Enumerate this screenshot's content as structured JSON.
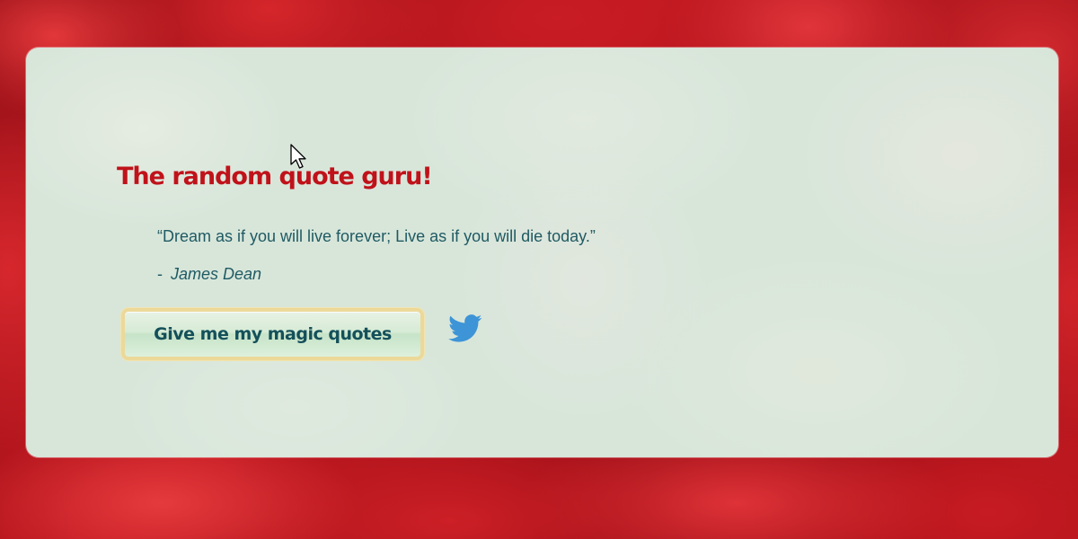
{
  "app": {
    "title": "The random quote guru!"
  },
  "quote": {
    "text": "“Dream as if you will live forever; Live as if you will die today.”",
    "dash": "-",
    "author": "James Dean"
  },
  "actions": {
    "new_quote_label": "Give me my magic quotes",
    "tweet_icon": "twitter-bird-icon"
  },
  "colors": {
    "title": "#c0121a",
    "text": "#1f5a63",
    "button_text": "#14505a",
    "button_border": "#ecd99a",
    "twitter_blue": "#3d94d6",
    "card_background": "#d8e6da",
    "page_background": "#b3141c"
  }
}
